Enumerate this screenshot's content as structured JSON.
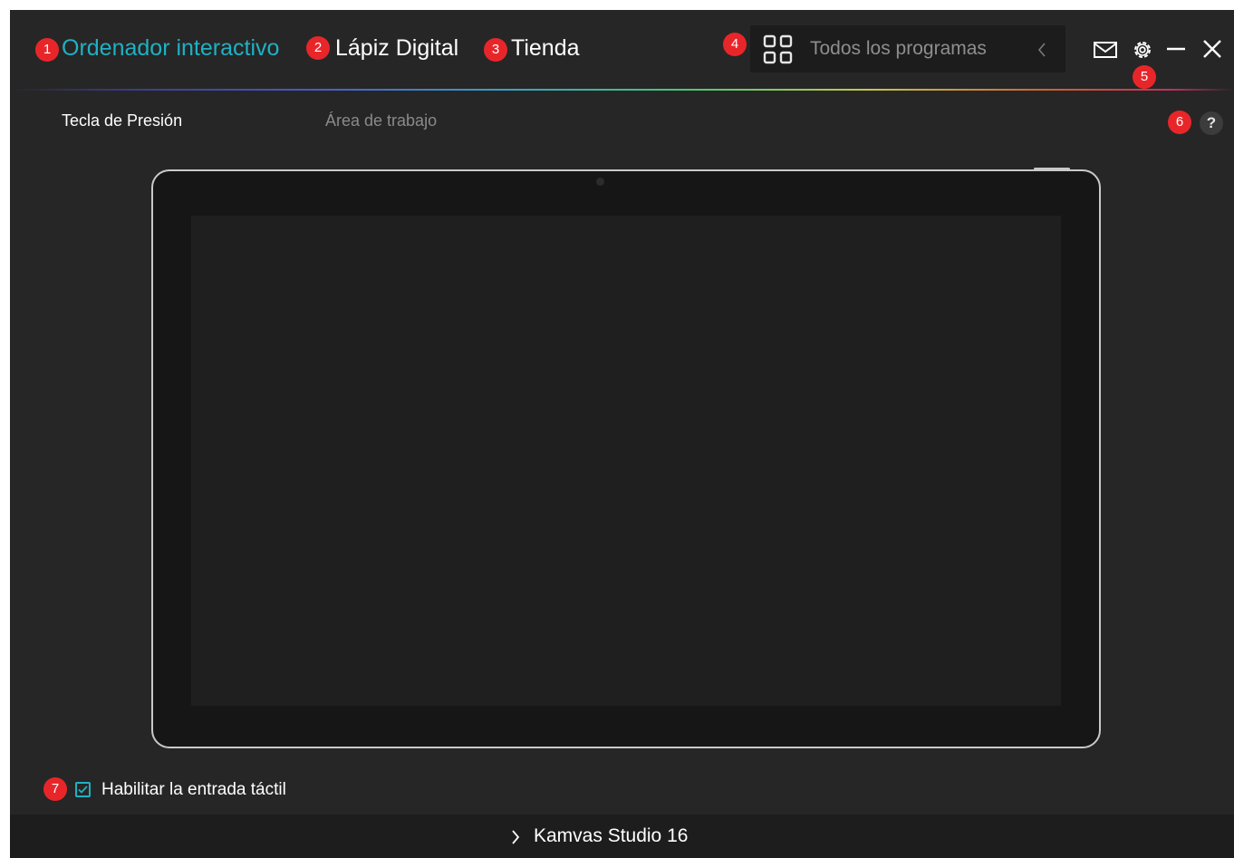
{
  "nav": {
    "items": [
      {
        "badge": "1",
        "label": "Ordenador interactivo"
      },
      {
        "badge": "2",
        "label": "Lápiz Digital"
      },
      {
        "badge": "3",
        "label": "Tienda"
      }
    ]
  },
  "program_selector": {
    "badge": "4",
    "label": "Todos los programas",
    "icon": "grid-icon",
    "collapse_icon": "chevron-left-icon"
  },
  "window_controls": {
    "settings_badge": "5",
    "icons": [
      "mail-icon",
      "gear-icon",
      "minimize-icon",
      "close-icon"
    ]
  },
  "tabs": [
    {
      "label": "Tecla de Presión",
      "active": true
    },
    {
      "label": "Área de trabajo",
      "active": false
    }
  ],
  "help": {
    "badge": "6",
    "label": "?"
  },
  "touch": {
    "badge": "7",
    "label": "Habilitar la entrada táctil",
    "checked": true
  },
  "footer": {
    "device_name": "Kamvas Studio 16",
    "icon": "chevron-right-icon"
  },
  "colors": {
    "accent": "#1fb1c4",
    "badge": "#e8262a",
    "background": "#262626"
  }
}
